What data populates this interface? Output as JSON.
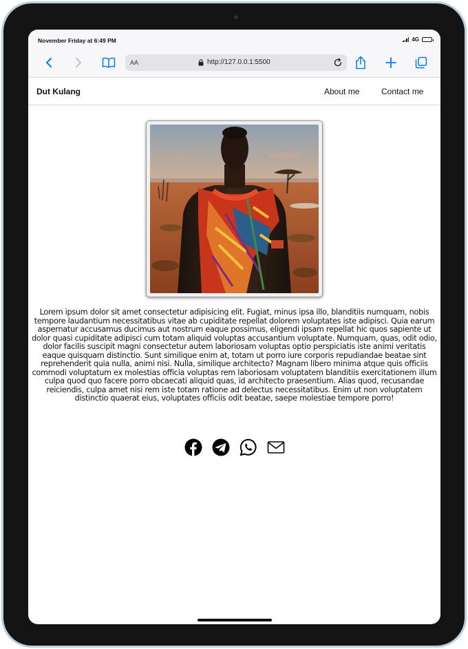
{
  "status_bar": {
    "time": "November Friday at 6:49 PM",
    "network": "4G"
  },
  "browser": {
    "aa_label": "AA",
    "url": "http://127.0.0.1:5500",
    "icons": [
      "back-icon",
      "forward-icon",
      "bookmarks-icon",
      "lock-icon",
      "reload-icon",
      "share-icon",
      "new-tab-icon",
      "tabs-icon"
    ]
  },
  "site_nav": {
    "brand": "Dut Kulang",
    "links": [
      "About me",
      "Contact me"
    ]
  },
  "main": {
    "bio": "Lorem ipsum dolor sit amet consectetur adipisicing elit. Fugiat, minus ipsa illo, blanditiis numquam, nobis tempore laudantium necessitatibus vitae ab cupiditate repellat dolorem voluptates iste adipisci. Quia earum aspernatur accusamus ducimus aut nostrum eaque possimus, eligendi ipsam repellat hic quos sapiente ut dolor quasi cupiditate adipisci cum totam aliquid voluptas accusantium voluptate. Numquam, quas, odit odio, dolor facilis suscipit magni consectetur autem laboriosam voluptas optio perspiciatis iste animi veritatis eaque quisquam distinctio. Sunt similique enim at, totam ut porro iure corporis repudiandae beatae sint reprehenderit quia nulla, animi nisi. Nulla, similique architecto? Magnam libero minima atque quis officiis commodi voluptatum ex molestias officia voluptas rem laboriosam voluptatem blanditiis exercitationem illum culpa quod quo facere porro obcaecati aliquid quas, id architecto praesentium. Alias quod, recusandae reiciendis, culpa amet nisi rem iste totam ratione ad delectus necessitatibus. Enim ut non voluptatem distinctio quaerat eius, voluptates officiis odit beatae, saepe molestiae tempore porro!",
    "social_icons": [
      "facebook-icon",
      "telegram-icon",
      "whatsapp-icon",
      "mail-icon"
    ]
  },
  "colors": {
    "accent": "#007aff",
    "device_frame": "#141414",
    "device_edge": "#b9cfe0",
    "text": "#111111"
  }
}
